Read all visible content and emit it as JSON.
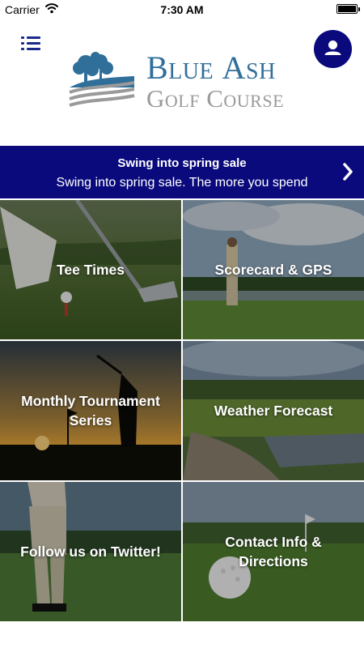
{
  "status_bar": {
    "carrier": "Carrier",
    "time": "7:30 AM",
    "wifi_icon": "wifi-icon",
    "battery_icon": "battery-icon"
  },
  "header": {
    "menu_icon": "list-menu-icon",
    "profile_icon": "user-icon",
    "logo": {
      "line1_first": "B",
      "line1_rest": "lue ",
      "line1_first2": "A",
      "line1_rest2": "sh",
      "line2_first": "G",
      "line2_rest": "olf ",
      "line2_first2": "C",
      "line2_rest2": "ourse"
    }
  },
  "promo": {
    "title": "Swing into spring sale",
    "text": "Swing into spring sale. The more you spend",
    "chevron_icon": "chevron-right-icon"
  },
  "tiles": [
    {
      "label": "Tee Times"
    },
    {
      "label": "Scorecard & GPS"
    },
    {
      "label": "Monthly Tournament Series"
    },
    {
      "label": "Weather Forecast"
    },
    {
      "label": "Follow us on Twitter!"
    },
    {
      "label": "Contact Info & Directions"
    }
  ],
  "colors": {
    "brand_navy": "#0a0a7d",
    "logo_blue": "#2f6f9a",
    "logo_gray": "#9a9a9a"
  }
}
